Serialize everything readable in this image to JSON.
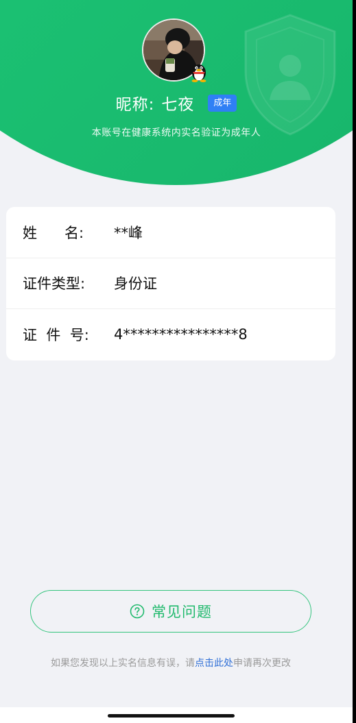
{
  "profile": {
    "nickname_label": "昵称:",
    "nickname": "七夜",
    "age_badge": "成年",
    "verify_text": "本账号在健康系统内实名验证为成年人"
  },
  "info": {
    "rows": [
      {
        "label": "姓      名:",
        "value": "**峰"
      },
      {
        "label": "证件类型:",
        "value": "身份证"
      },
      {
        "label": "证  件  号:",
        "value": "4****************8"
      }
    ]
  },
  "faq": {
    "label": "常见问题",
    "icon": "question-circle-icon"
  },
  "footer": {
    "prefix": "如果您发现以上实名信息有误，请",
    "link": "点击此处",
    "suffix": "申请再次更改"
  },
  "colors": {
    "header_green": "#1cc46e",
    "badge_blue": "#2f80f5",
    "faq_green": "#1fb96c",
    "link_blue": "#2f6fd6"
  }
}
